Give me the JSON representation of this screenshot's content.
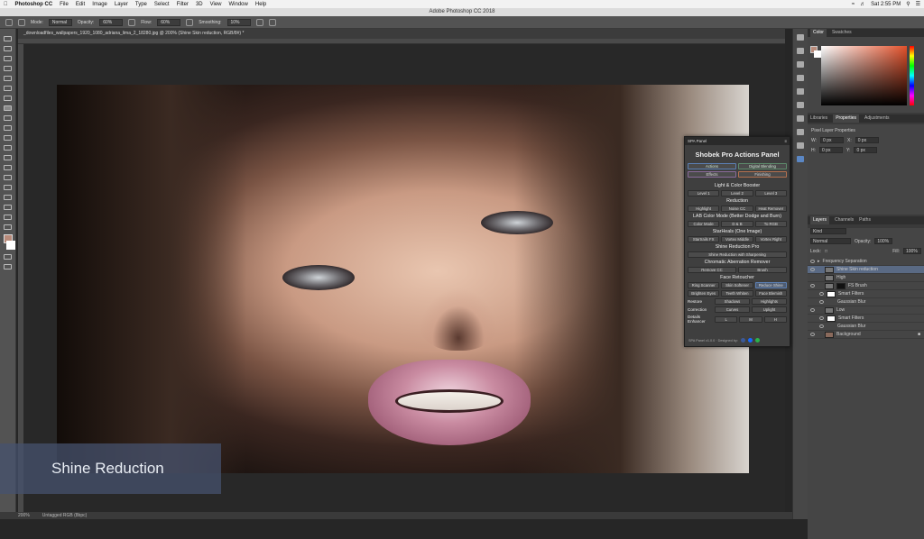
{
  "menubar": {
    "app_name": "Photoshop CC",
    "items": [
      "File",
      "Edit",
      "Image",
      "Layer",
      "Type",
      "Select",
      "Filter",
      "3D",
      "View",
      "Window",
      "Help"
    ],
    "clock": "Sat 2:55 PM"
  },
  "window_title": "Adobe Photoshop CC 2018",
  "options": {
    "mode_label": "Mode:",
    "mode_value": "Normal",
    "opacity_label": "Opacity:",
    "opacity_value": "60%",
    "flow_label": "Flow:",
    "flow_value": "60%",
    "smoothing_label": "Smoothing:",
    "smoothing_value": "10%"
  },
  "document": {
    "tab_title": "_downloadfiles_wallpapers_1920_1080_adriana_lima_2_18280.jpg @ 200% (Shine Skin reduction, RGB/8#) *"
  },
  "caption": "Shine Reduction",
  "status": {
    "zoom": "200%",
    "profile": "Untagged RGB (8bpc)"
  },
  "panels": {
    "color_tabs": [
      "Color",
      "Swatches"
    ],
    "props_tabs": [
      "Libraries",
      "Properties",
      "Adjustments"
    ],
    "props_title": "Pixel Layer Properties",
    "props_fields": [
      {
        "label": "W:",
        "value": "0 px"
      },
      {
        "label": "X:",
        "value": "0 px"
      },
      {
        "label": "H:",
        "value": "0 px"
      },
      {
        "label": "Y:",
        "value": "0 px"
      }
    ],
    "layer_tabs": [
      "Layers",
      "Channels",
      "Paths"
    ],
    "layer_kind": "Kind",
    "blend_mode": "Normal",
    "opacity_label": "Opacity:",
    "opacity_value": "100%",
    "lock_label": "Lock:",
    "fill_label": "Fill:",
    "fill_value": "100%",
    "layers": [
      {
        "name": "Frequency Separation",
        "selected": false
      },
      {
        "name": "Shine Skin reduction",
        "selected": true
      },
      {
        "name": "High",
        "selected": false
      },
      {
        "name": "FS Brush",
        "selected": false
      },
      {
        "name": "Smart Filters",
        "selected": false
      },
      {
        "name": "Gaussian Blur",
        "selected": false
      },
      {
        "name": "Low",
        "selected": false
      },
      {
        "name": "Smart Filters",
        "selected": false
      },
      {
        "name": "Gaussian Blur",
        "selected": false
      },
      {
        "name": "Background",
        "selected": false
      }
    ]
  },
  "spa": {
    "tab": "SPA Panel",
    "title": "Shobek Pro Actions Panel",
    "tabs_row1": [
      "Actions",
      "Digital Blending"
    ],
    "tabs_row2": [
      "Effects",
      "Finishing"
    ],
    "sec_light": "Light & Color Booster",
    "light_btns": [
      "Level 1",
      "Level 2",
      "Level 3"
    ],
    "sec_reduction": "Reduction",
    "reduction_btns": [
      "Highlight",
      "Noise CC",
      "Heat Remover"
    ],
    "sec_lab": "LAB Color Mode (Better Dodge and Burn)",
    "lab_btns": [
      "Color Mode",
      "D & B",
      "To RGB"
    ],
    "sec_startrails": "StarHeals (One Image)",
    "startrails_btns": [
      "Startrails FX",
      "Vortex Middle",
      "Vortex Right"
    ],
    "sec_shine": "Shine Reduction Pro",
    "shine_btn": "Shine Reduction with Sharpening",
    "sec_chroma": "Chromatic Aberration Remover",
    "chroma_btns": [
      "Remove CC",
      "Brush"
    ],
    "sec_face": "Face Retoucher",
    "face_row1": [
      "Ring Scanner",
      "Skin Softener",
      "Reduce Shine"
    ],
    "face_row2": [
      "Brighten Eyes",
      "Teeth Whiten",
      "Face Blemish"
    ],
    "restore_label": "Restore",
    "restore_btns": [
      "Shadows",
      "Highlights"
    ],
    "correction_label": "Correction",
    "correction_btns": [
      "Curves",
      "Uplight"
    ],
    "details_label": "Details Enhancer",
    "details_btns": [
      "L",
      "M",
      "H"
    ],
    "footer": "SPA Panel v1.0.0 · Designed by:"
  }
}
